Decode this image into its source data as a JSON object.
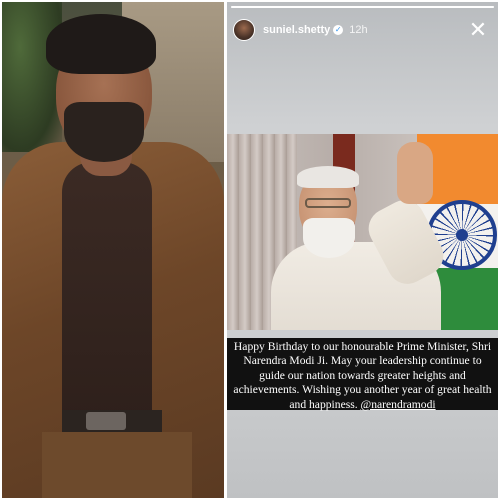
{
  "left_photo": {
    "alt": "Suniel Shetty portrait"
  },
  "story": {
    "username": "suniel.shetty",
    "verified_icon": "verified-check-icon",
    "time": "12h",
    "close_icon": "close-icon",
    "progress": 1.0,
    "photo": {
      "subject": "Narendra Modi waving"
    },
    "caption": {
      "text": "Happy Birthday to our honourable Prime Minister, Shri Narendra Modi Ji. May your leadership continue to guide our nation towards greater heights and achievements. Wishing you another year of great health and happiness.",
      "mention": "@narendramodi"
    }
  },
  "colors": {
    "flag_saffron": "#f28a2f",
    "flag_green": "#2e8c3c",
    "chakra_blue": "#1f3f8f",
    "verified_blue": "#3897f0"
  }
}
